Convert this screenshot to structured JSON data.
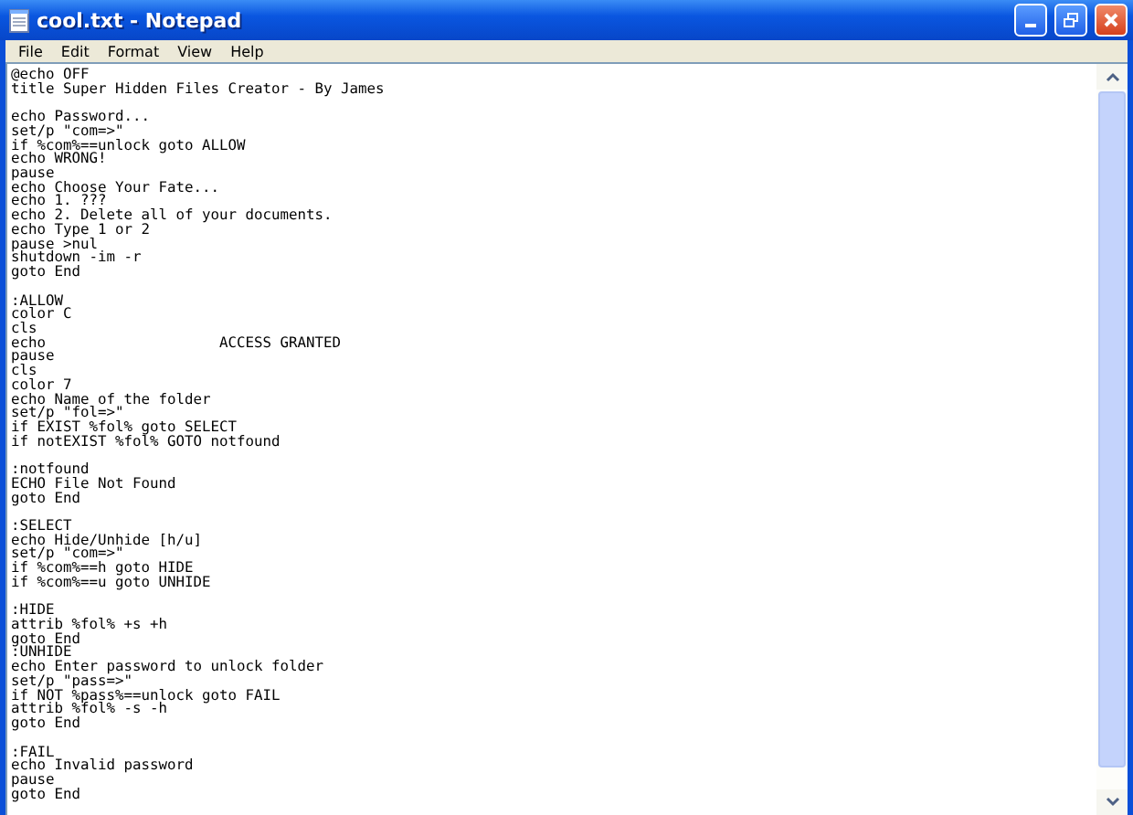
{
  "window": {
    "title": "cool.txt - Notepad"
  },
  "menu": [
    "File",
    "Edit",
    "Format",
    "View",
    "Help"
  ],
  "editor": {
    "blocks": [
      [
        "@echo OFF",
        "title Super Hidden Files Creator - By James"
      ],
      [
        "echo Password...",
        "set/p \"com=>\"",
        "if %com%==unlock goto ALLOW",
        "echo WRONG!",
        "pause",
        "echo Choose Your Fate...",
        "echo 1. ???",
        "echo 2. Delete all of your documents.",
        "echo Type 1 or 2",
        "pause >nul",
        "shutdown -im -r",
        "goto End"
      ],
      [
        ":ALLOW",
        "color C",
        "cls",
        "echo                    ACCESS GRANTED",
        "pause",
        "cls",
        "color 7",
        "echo Name of the folder",
        "set/p \"fol=>\"",
        "if EXIST %fol% goto SELECT",
        "if notEXIST %fol% GOTO notfound"
      ],
      [
        ":notfound",
        "ECHO File Not Found",
        "goto End"
      ],
      [
        ":SELECT",
        "echo Hide/Unhide [h/u]",
        "set/p \"com=>\"",
        "if %com%==h goto HIDE",
        "if %com%==u goto UNHIDE"
      ],
      [
        ":HIDE",
        "attrib %fol% +s +h",
        "goto End",
        ":UNHIDE",
        "echo Enter password to unlock folder",
        "set/p \"pass=>\"",
        "if NOT %pass%==unlock goto FAIL",
        "attrib %fol% -s -h",
        "goto End"
      ],
      [
        ":FAIL",
        "echo Invalid password",
        "pause",
        "goto End"
      ]
    ]
  }
}
